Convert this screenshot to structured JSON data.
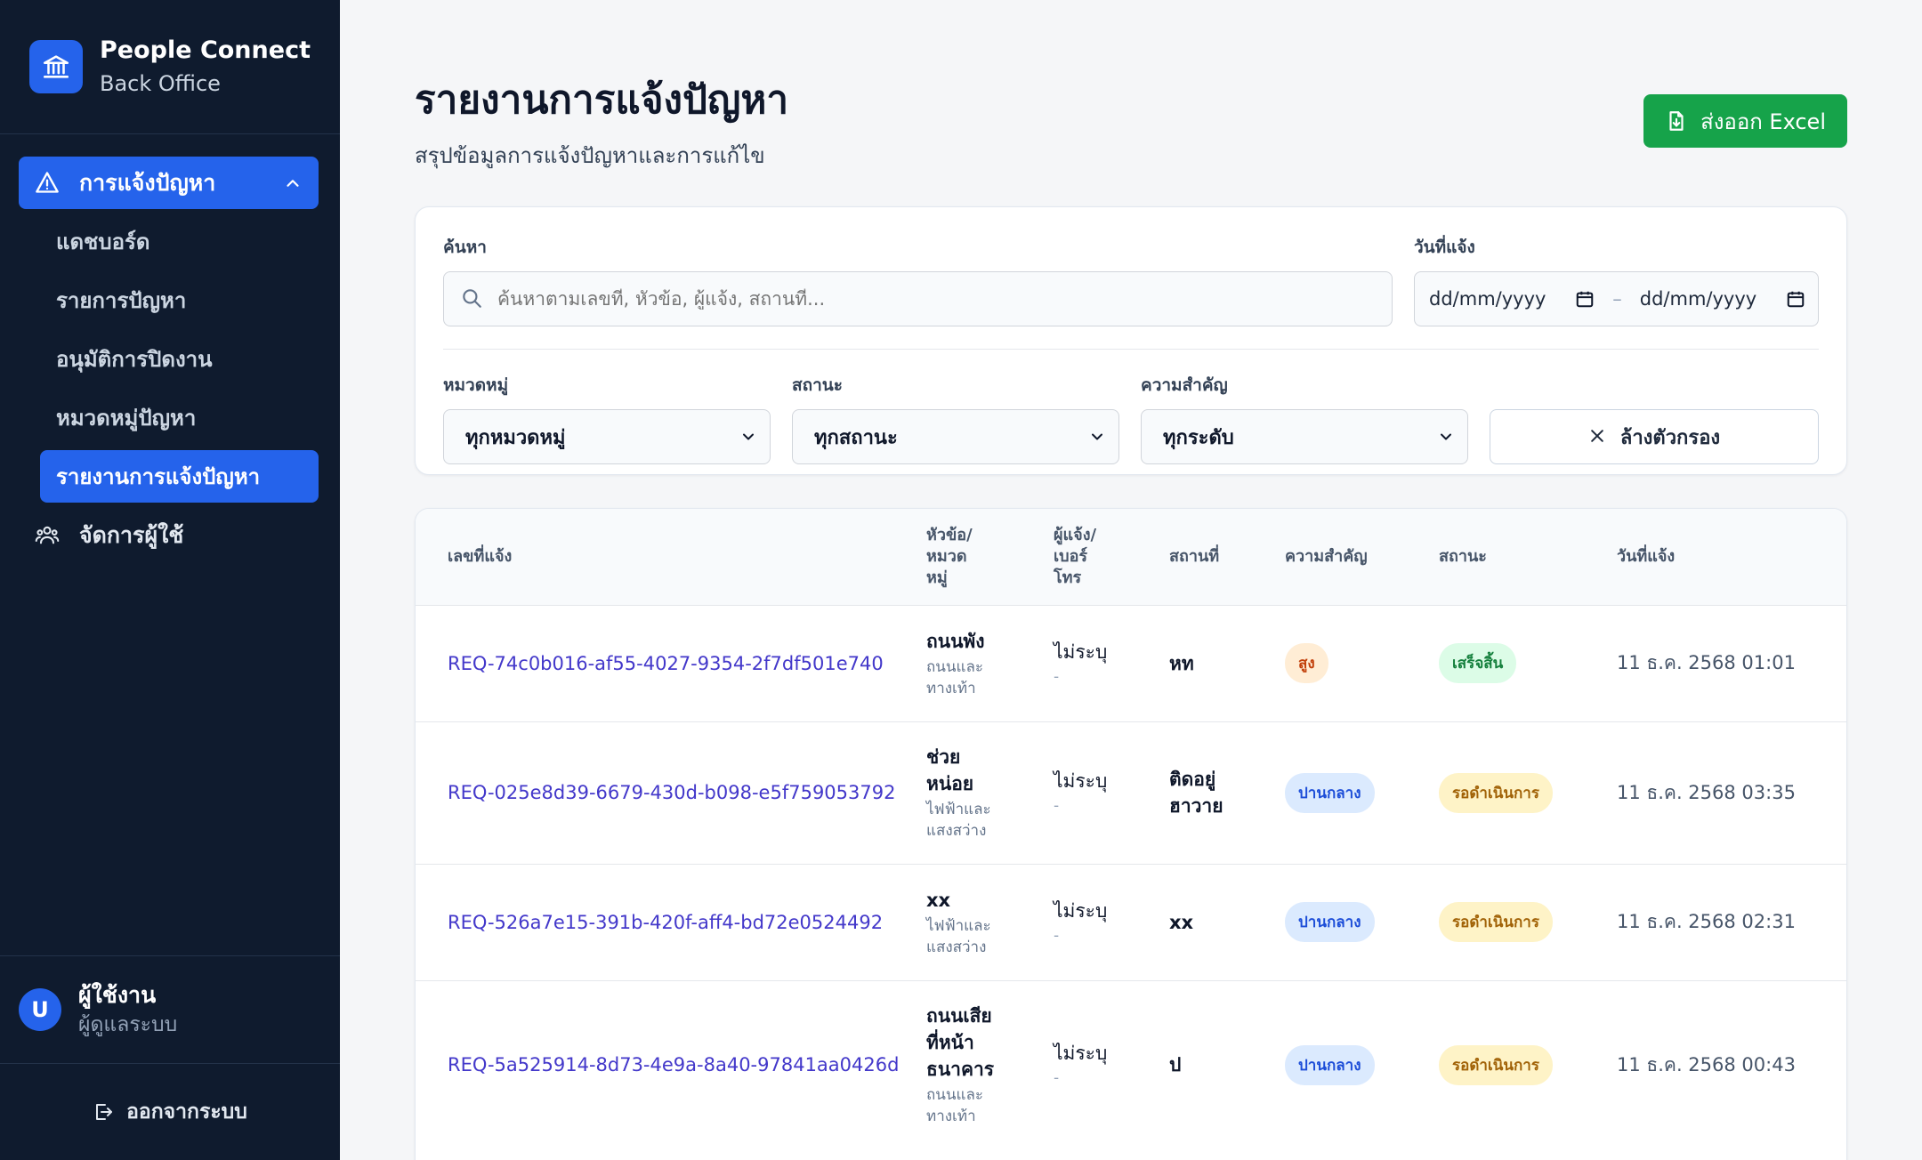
{
  "brand": {
    "title": "People Connect",
    "subtitle": "Back Office"
  },
  "sidebar": {
    "group": {
      "label": "การแจ้งปัญหา",
      "icon": "warning-icon"
    },
    "sub_items": [
      {
        "label": "แดชบอร์ด",
        "active": false
      },
      {
        "label": "รายการปัญหา",
        "active": false
      },
      {
        "label": "อนุมัติการปิดงาน",
        "active": false
      },
      {
        "label": "หมวดหมู่ปัญหา",
        "active": false
      },
      {
        "label": "รายงานการแจ้งปัญหา",
        "active": true
      }
    ],
    "manage_users": {
      "label": "จัดการผู้ใช้",
      "icon": "users-icon"
    }
  },
  "user": {
    "initial": "U",
    "name": "ผู้ใช้งาน",
    "role": "ผู้ดูแลระบบ"
  },
  "logout": {
    "label": "ออกจากระบบ"
  },
  "page": {
    "title": "รายงานการแจ้งปัญหา",
    "subtitle": "สรุปข้อมูลการแจ้งปัญหาและการแก้ไข",
    "export_label": "ส่งออก Excel"
  },
  "filters": {
    "search_label": "ค้นหา",
    "search_placeholder": "ค้นหาตามเลขที่, หัวข้อ, ผู้แจ้ง, สถานที่...",
    "date_label": "วันที่แจ้ง",
    "date_from": "dd/mm/yyyy",
    "date_to": "dd/mm/yyyy",
    "date_sep": "–",
    "category_label": "หมวดหมู่",
    "category_value": "ทุกหมวดหมู่",
    "status_label": "สถานะ",
    "status_value": "ทุกสถานะ",
    "priority_label": "ความสำคัญ",
    "priority_value": "ทุกระดับ",
    "clear_label": "ล้างตัวกรอง"
  },
  "table": {
    "headers": {
      "id": "เลขที่แจ้ง",
      "topic": "หัวข้อ/ หมวด หมู่",
      "reporter": "ผู้แจ้ง/ เบอร์ โทร",
      "location": "สถานที่",
      "priority": "ความสำคัญ",
      "status": "สถานะ",
      "date": "วันที่แจ้ง"
    },
    "rows": [
      {
        "id": "REQ-74c0b016-af55-4027-9354-2f7df501e740",
        "topic": "ถนนพัง",
        "category": "ถนนและ ทางเท้า",
        "reporter": "ไม่ระบุ",
        "phone": "-",
        "location": "หท",
        "priority": "สูง",
        "status": "เสร็จสิ้น",
        "date": "11 ธ.ค. 2568 01:01"
      },
      {
        "id": "REQ-025e8d39-6679-430d-b098-e5f759053792",
        "topic": "ช่วย หน่อย",
        "category": "ไฟฟ้าและ แสงสว่าง",
        "reporter": "ไม่ระบุ",
        "phone": "-",
        "location": "ติดอยู่ ฮาวาย",
        "priority": "ปานกลาง",
        "status": "รอดำเนินการ",
        "date": "11 ธ.ค. 2568 03:35"
      },
      {
        "id": "REQ-526a7e15-391b-420f-aff4-bd72e0524492",
        "topic": "xx",
        "category": "ไฟฟ้าและ แสงสว่าง",
        "reporter": "ไม่ระบุ",
        "phone": "-",
        "location": "xx",
        "priority": "ปานกลาง",
        "status": "รอดำเนินการ",
        "date": "11 ธ.ค. 2568 02:31"
      },
      {
        "id": "REQ-5a525914-8d73-4e9a-8a40-97841aa0426d",
        "topic": "ถนนเสีย ที่หน้า ธนาคาร",
        "category": "ถนนและ ทางเท้า",
        "reporter": "ไม่ระบุ",
        "phone": "-",
        "location": "ป",
        "priority": "ปานกลาง",
        "status": "รอดำเนินการ",
        "date": "11 ธ.ค. 2568 00:43"
      }
    ]
  },
  "colors": {
    "sidebar_bg": "#0f1b2e",
    "accent": "#2563eb",
    "export_green": "#16a34a",
    "link": "#4338ca",
    "priority_high_bg": "#ffedd5",
    "priority_high_fg": "#c2410c",
    "priority_mid_bg": "#dbeafe",
    "priority_mid_fg": "#1d4ed8",
    "status_done_bg": "#dcfce7",
    "status_done_fg": "#15803d",
    "status_wait_bg": "#fef3c7",
    "status_wait_fg": "#a16207"
  }
}
